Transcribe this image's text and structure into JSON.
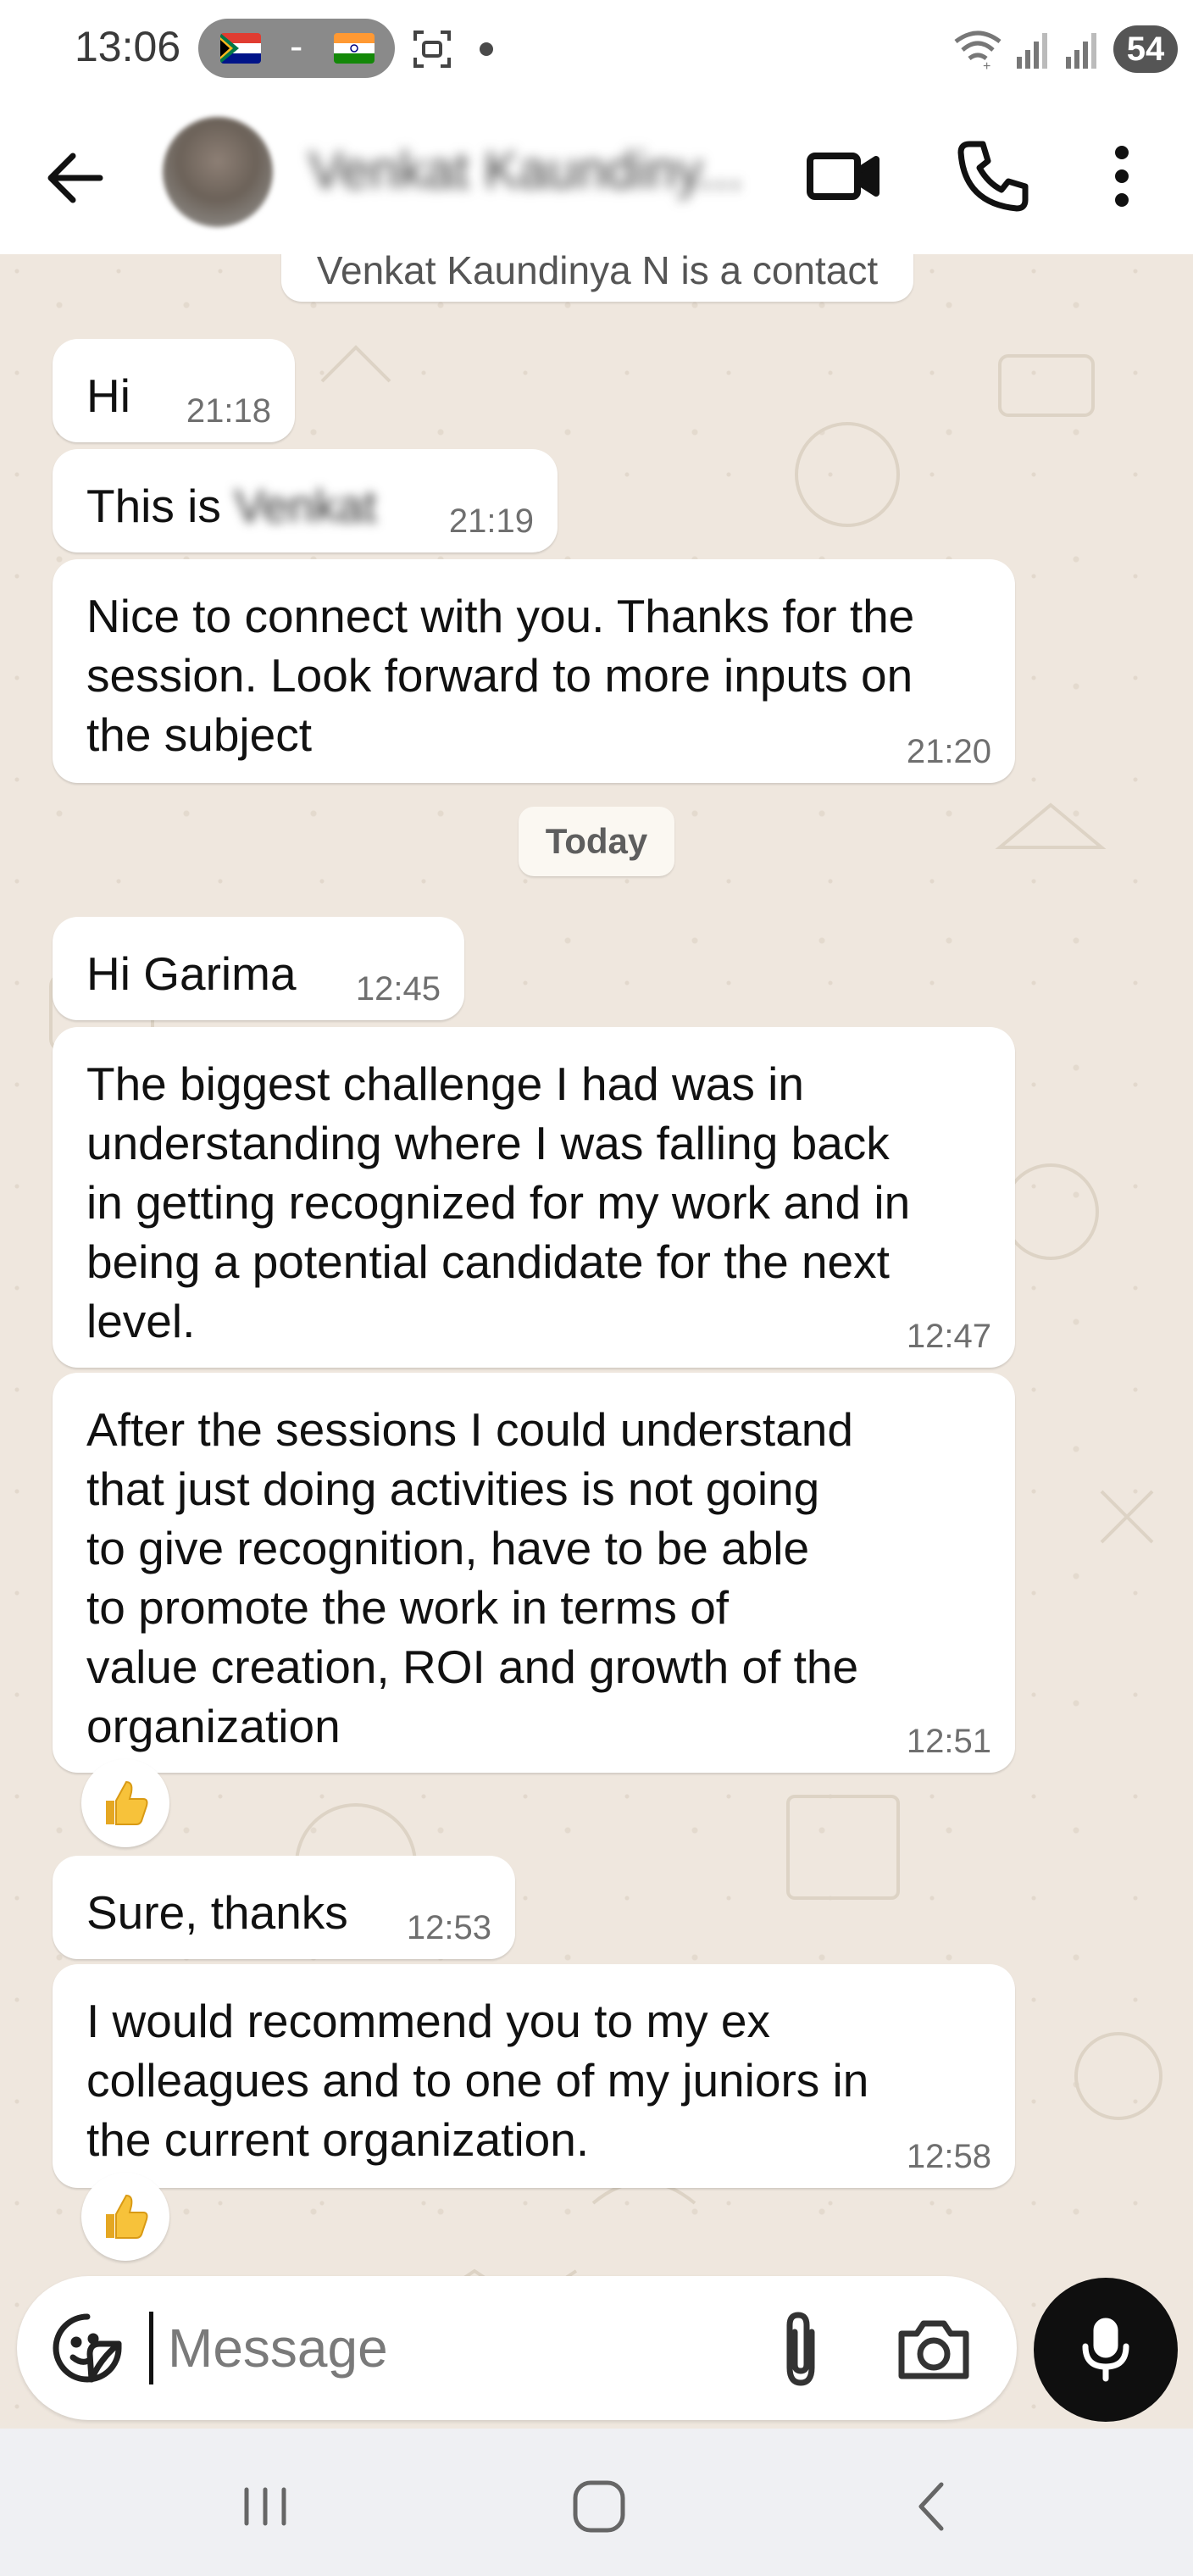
{
  "status_bar": {
    "time": "13:06",
    "pill_separator": "-",
    "battery": "54"
  },
  "header": {
    "contact_name": "Venkat Kaundiny..."
  },
  "chat": {
    "system_notice": "Venkat Kaundinya N is a contact",
    "date_divider": "Today",
    "messages": [
      {
        "lines": [
          "Hi"
        ],
        "time": "21:18"
      },
      {
        "prefix": "This is ",
        "name": "Venkat",
        "time": "21:19"
      },
      {
        "lines": [
          "Nice to connect with you. Thanks for the",
          "session. Look forward to more inputs on",
          "the subject"
        ],
        "time": "21:20"
      },
      {
        "lines": [
          "Hi Garima"
        ],
        "time": "12:45"
      },
      {
        "lines": [
          "The biggest challenge I had was in",
          "understanding where I was falling back",
          "in getting recognized for my work and in",
          "being a potential candidate for the next",
          "level."
        ],
        "time": "12:47"
      },
      {
        "lines": [
          "After the sessions I could understand",
          "that just doing activities is not going",
          "to give recognition, have to be able",
          "to promote the work in terms of",
          "value creation, ROI and growth of the",
          "organization"
        ],
        "time": "12:51",
        "reaction": "thumbs-up"
      },
      {
        "lines": [
          "Sure, thanks"
        ],
        "time": "12:53"
      },
      {
        "lines": [
          "I would recommend you to my ex",
          "colleagues and to one of my juniors in",
          "the current organization."
        ],
        "time": "12:58",
        "reaction": "thumbs-up"
      }
    ]
  },
  "composer": {
    "placeholder": "Message"
  },
  "icons": {
    "back": "arrow-left-icon",
    "video": "video-camera-icon",
    "call": "phone-icon",
    "menu": "more-vertical-icon",
    "sticker": "sticker-icon",
    "attach": "paperclip-icon",
    "camera": "camera-icon",
    "mic": "microphone-icon",
    "reaction": "thumbs-up-icon"
  },
  "colors": {
    "chat_background": "#efe7de",
    "bubble": "#ffffff",
    "mic_button": "#0f0f0f",
    "nav_bar": "#eff0f3"
  }
}
